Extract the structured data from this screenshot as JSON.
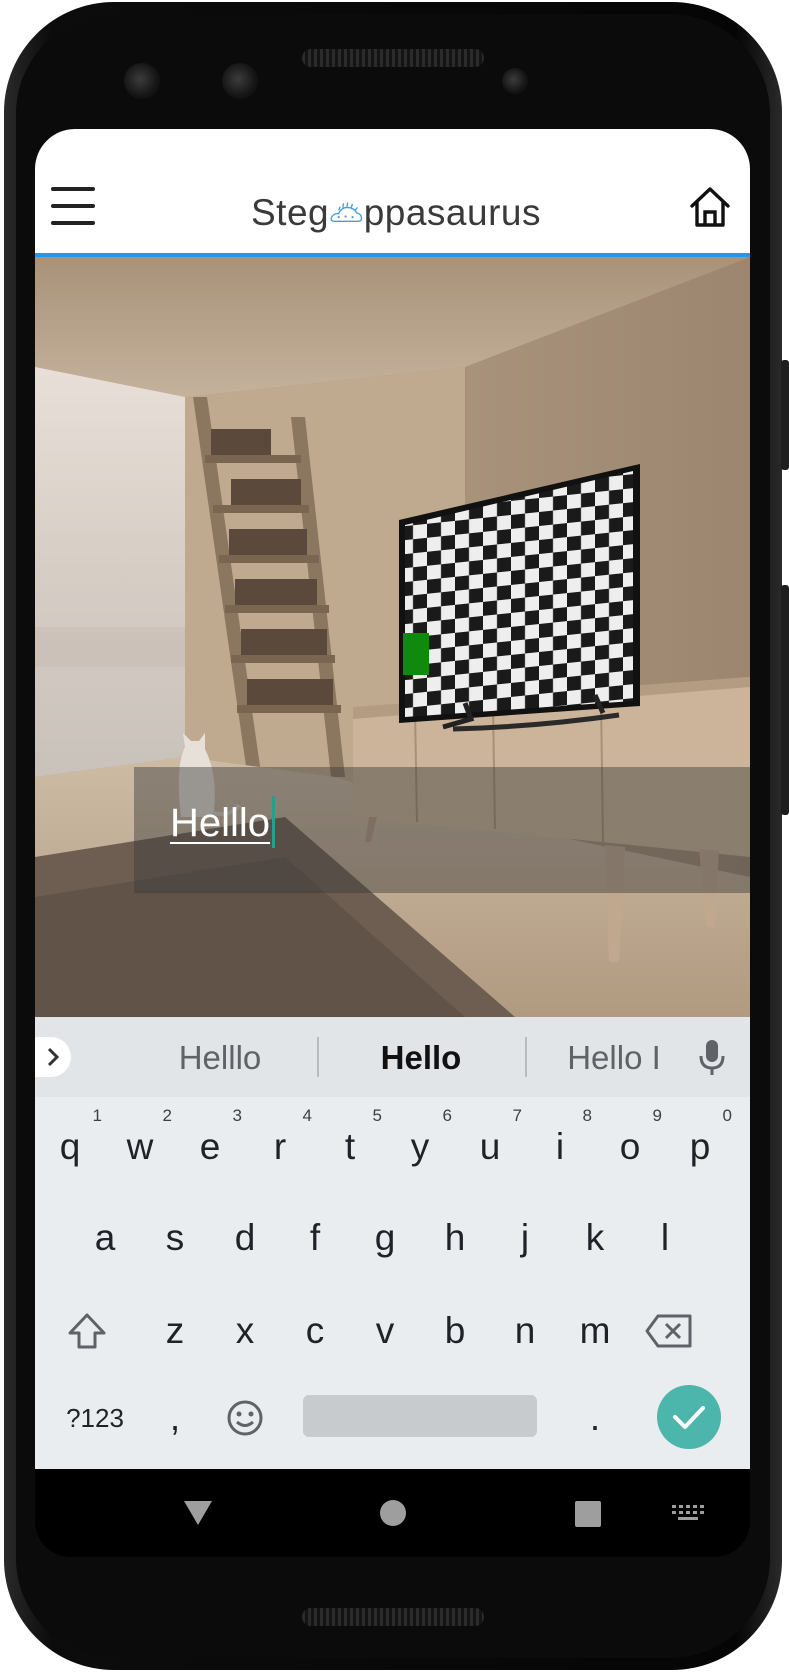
{
  "app": {
    "logo_prefix": "Steg",
    "logo_suffix": "ppasaurus",
    "menu_icon": "hamburger-menu-icon",
    "home_icon": "home-icon"
  },
  "editor": {
    "text_value": "Helllo",
    "image_description_icon": "steganography-image"
  },
  "keyboard": {
    "suggestions": [
      "Helllo",
      "Hello",
      "Hello I"
    ],
    "row1": [
      {
        "label": "q",
        "hint": "1"
      },
      {
        "label": "w",
        "hint": "2"
      },
      {
        "label": "e",
        "hint": "3"
      },
      {
        "label": "r",
        "hint": "4"
      },
      {
        "label": "t",
        "hint": "5"
      },
      {
        "label": "y",
        "hint": "6"
      },
      {
        "label": "u",
        "hint": "7"
      },
      {
        "label": "i",
        "hint": "8"
      },
      {
        "label": "o",
        "hint": "9"
      },
      {
        "label": "p",
        "hint": "0"
      }
    ],
    "row2": [
      "a",
      "s",
      "d",
      "f",
      "g",
      "h",
      "j",
      "k",
      "l"
    ],
    "row3": [
      "z",
      "x",
      "c",
      "v",
      "b",
      "n",
      "m"
    ],
    "symbols_label": "?123",
    "comma_label": ",",
    "period_label": ".",
    "accent_color": "#4db6ac"
  },
  "colors": {
    "appbar_line": "#2196f3",
    "keyboard_bg": "#e9edf0"
  }
}
